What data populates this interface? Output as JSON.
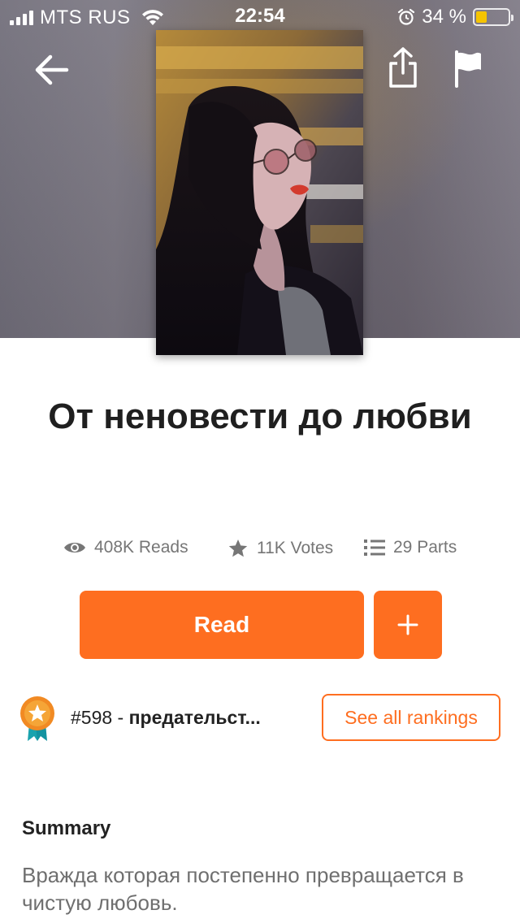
{
  "status_bar": {
    "carrier": "MTS RUS",
    "time": "22:54",
    "battery_percent": "34 %",
    "battery_level": 0.34,
    "signal_bars": 4,
    "icons": [
      "signal-icon",
      "wifi-icon",
      "alarm-icon",
      "battery-icon"
    ]
  },
  "nav": {
    "back_icon": "back-arrow-icon",
    "share_icon": "share-icon",
    "report_icon": "flag-icon"
  },
  "story": {
    "title": "От неновести до любви",
    "stats": {
      "reads": "408K Reads",
      "votes": "11K Votes",
      "parts": "29 Parts"
    }
  },
  "actions": {
    "read_label": "Read",
    "add_icon": "plus-icon"
  },
  "ranking": {
    "rank": "#598",
    "separator": " - ",
    "tag": "предательст...",
    "see_all_label": "See all rankings"
  },
  "summary": {
    "heading": "Summary",
    "text": "Вражда которая постепенно превращается в чистую любовь."
  },
  "colors": {
    "accent": "#fe6e20",
    "muted_text": "#767676",
    "battery_fill": "#f5c400"
  }
}
